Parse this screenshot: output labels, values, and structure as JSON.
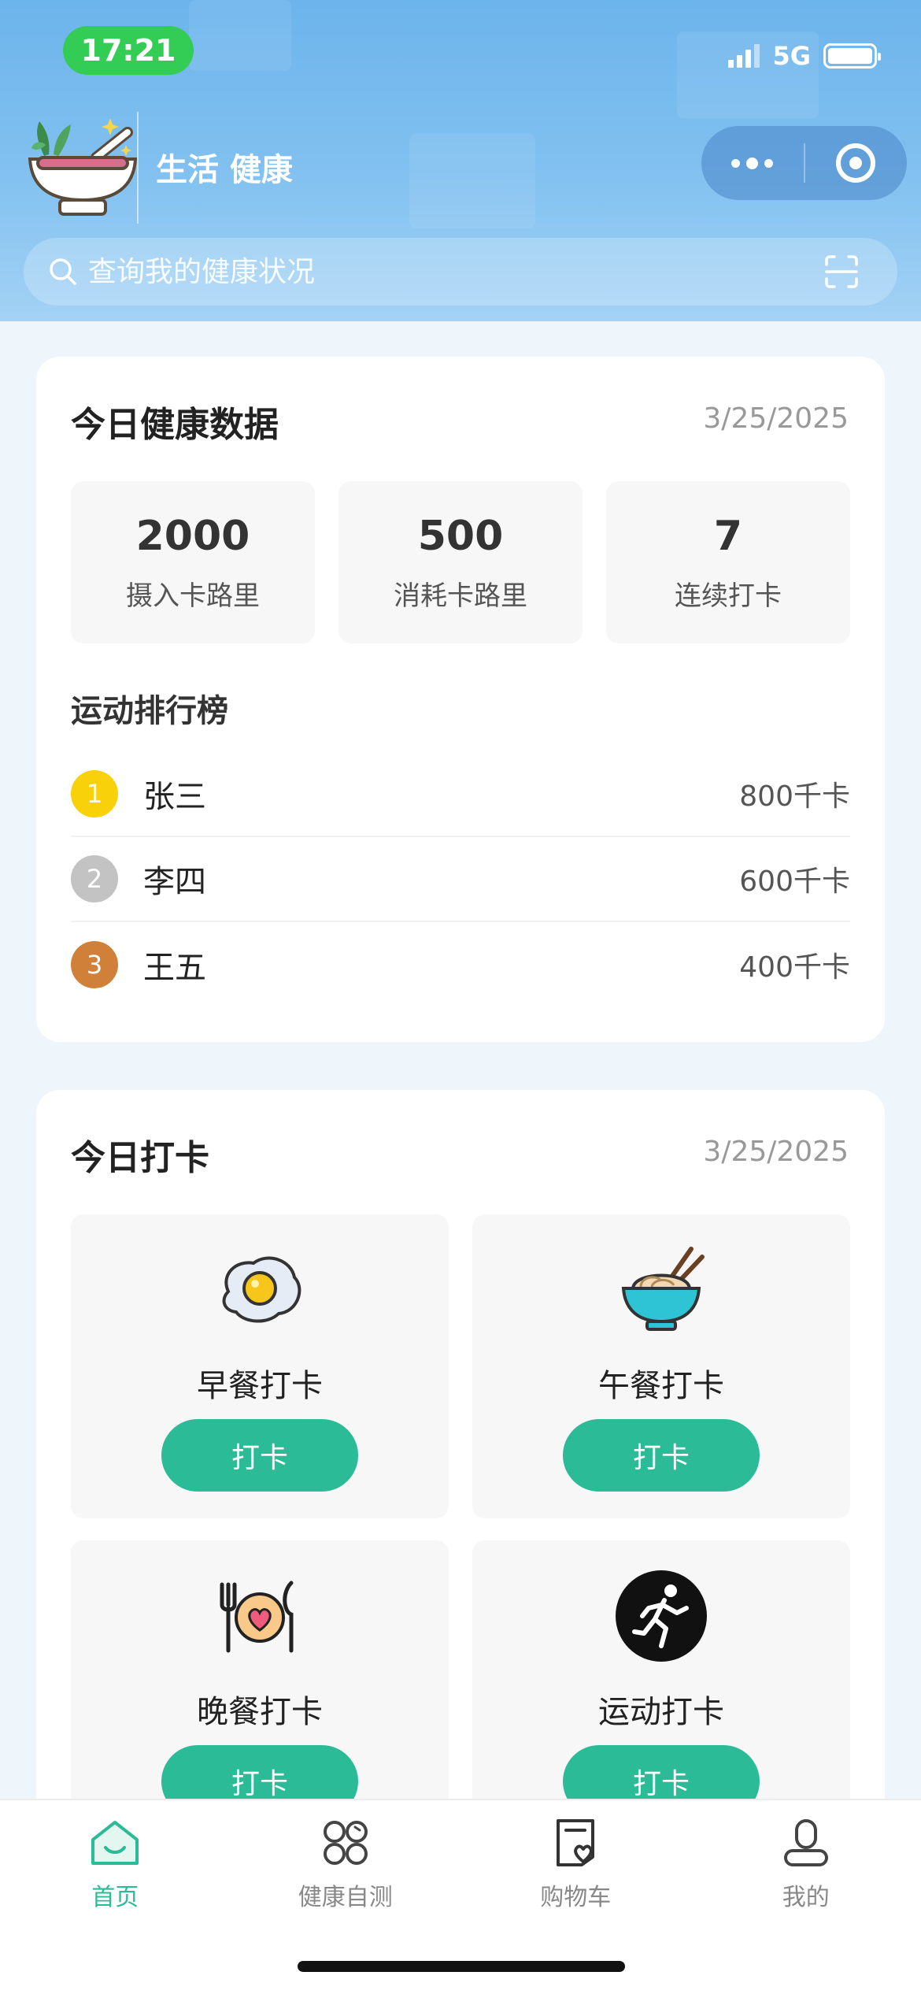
{
  "status_bar": {
    "time": "17:21",
    "network": "5G",
    "battery_level": 1.0
  },
  "header": {
    "brand_text": "生活 健康",
    "search": {
      "placeholder": "查询我的健康状况"
    }
  },
  "health_card": {
    "title": "今日健康数据",
    "date": "3/25/2025",
    "stats": [
      {
        "value": "2000",
        "label": "摄入卡路里"
      },
      {
        "value": "500",
        "label": "消耗卡路里"
      },
      {
        "value": "7",
        "label": "连续打卡"
      }
    ],
    "ranking": {
      "title": "运动排行榜",
      "rows": [
        {
          "rank": "1",
          "name": "张三",
          "value": "800千卡",
          "medal_color": "#f8d10a"
        },
        {
          "rank": "2",
          "name": "李四",
          "value": "600千卡",
          "medal_color": "#c3c3c3"
        },
        {
          "rank": "3",
          "name": "王五",
          "value": "400千卡",
          "medal_color": "#d08038"
        }
      ]
    }
  },
  "checkin_card": {
    "title": "今日打卡",
    "date": "3/25/2025",
    "items": [
      {
        "label": "早餐打卡",
        "button": "打卡",
        "icon": "fried-egg-icon"
      },
      {
        "label": "午餐打卡",
        "button": "打卡",
        "icon": "noodle-bowl-icon"
      },
      {
        "label": "晚餐打卡",
        "button": "打卡",
        "icon": "dinner-plate-icon"
      },
      {
        "label": "运动打卡",
        "button": "打卡",
        "icon": "running-person-icon"
      }
    ]
  },
  "tabbar": {
    "accent_color": "#2bbb97",
    "items": [
      {
        "label": "首页",
        "icon": "home-icon",
        "active": true
      },
      {
        "label": "健康自测",
        "icon": "grid-apps-icon",
        "active": false
      },
      {
        "label": "购物车",
        "icon": "cart-heart-icon",
        "active": false
      },
      {
        "label": "我的",
        "icon": "person-icon",
        "active": false
      }
    ]
  }
}
